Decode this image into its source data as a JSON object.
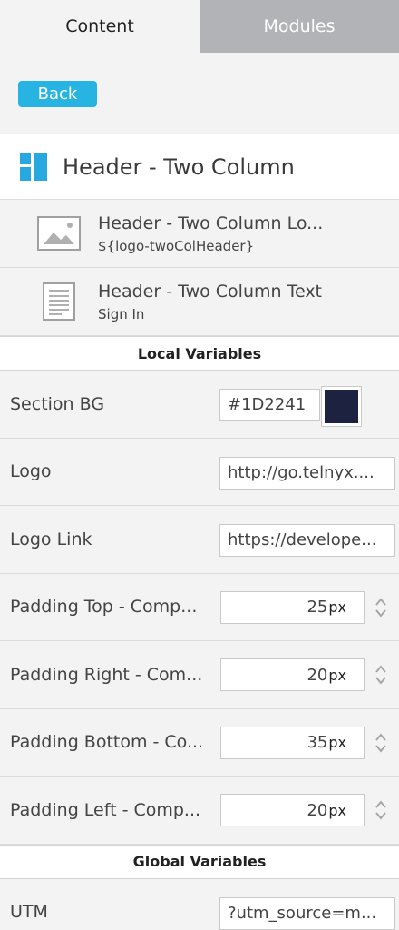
{
  "tabs": {
    "content": "Content",
    "modules": "Modules"
  },
  "back_label": "Back",
  "module": {
    "title": "Header - Two Column",
    "icon": "two-column-layout-icon",
    "icon_color": "#27a9e0"
  },
  "components": [
    {
      "title": "Header - Two Column Lo...",
      "subtitle": "${logo-twoColHeader}",
      "icon": "image-icon"
    },
    {
      "title": "Header - Two Column Text",
      "subtitle": "Sign In",
      "icon": "text-document-icon"
    }
  ],
  "local_variables": {
    "title": "Local Variables",
    "section_bg": {
      "label": "Section BG",
      "value": "#1D2241",
      "swatch_color": "#1d2241"
    },
    "logo": {
      "label": "Logo",
      "value": "http://go.telnyx...."
    },
    "logo_link": {
      "label": "Logo Link",
      "value": "https://develope..."
    },
    "padding_top": {
      "label": "Padding Top - Comp...",
      "value": "25",
      "unit": "px"
    },
    "padding_right": {
      "label": "Padding Right - Com...",
      "value": "20",
      "unit": "px"
    },
    "padding_bottom": {
      "label": "Padding Bottom - Co...",
      "value": "35",
      "unit": "px"
    },
    "padding_left": {
      "label": "Padding Left - Comp...",
      "value": "20",
      "unit": "px"
    }
  },
  "global_variables": {
    "title": "Global Variables",
    "utm": {
      "label": "UTM",
      "value": "?utm_source=m..."
    }
  },
  "colors": {
    "accent": "#27b4e3",
    "inactive_tab": "#b2b3b6"
  }
}
